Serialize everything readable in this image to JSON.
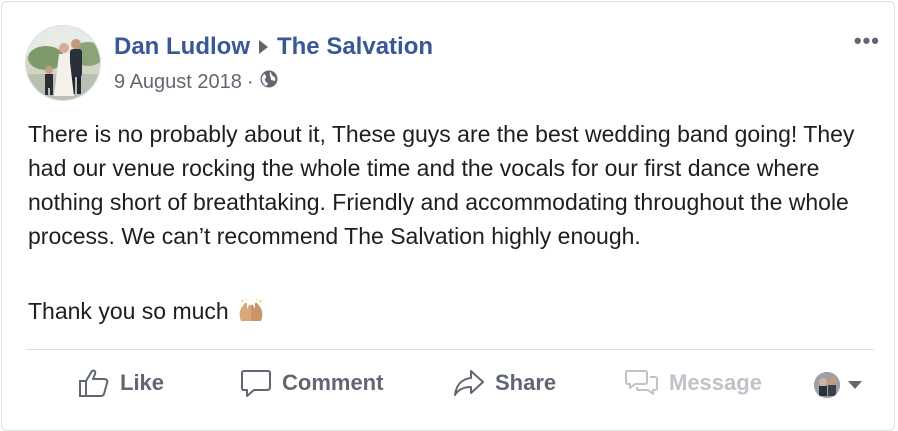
{
  "post": {
    "author": "Dan Ludlow",
    "target_page": "The Salvation",
    "date": "9 August 2018",
    "meta_separator": "·",
    "privacy_icon": "globe-icon",
    "more_label": "•••",
    "text": "There is no probably about it, These guys are the best wedding band going! They had our venue rocking the whole time and the vocals for our first dance where nothing short of breathtaking. Friendly and accommodating throughout the whole process. We can’t recommend The Salvation highly enough.",
    "thanks": "Thank you so much",
    "thanks_emoji_icon": "raising-hands-icon"
  },
  "actions": {
    "like": "Like",
    "comment": "Comment",
    "share": "Share",
    "message": "Message"
  },
  "colors": {
    "name_link": "#385898",
    "secondary_text": "#606770",
    "disabled_text": "#bec3c9",
    "divider": "#dadde1"
  }
}
